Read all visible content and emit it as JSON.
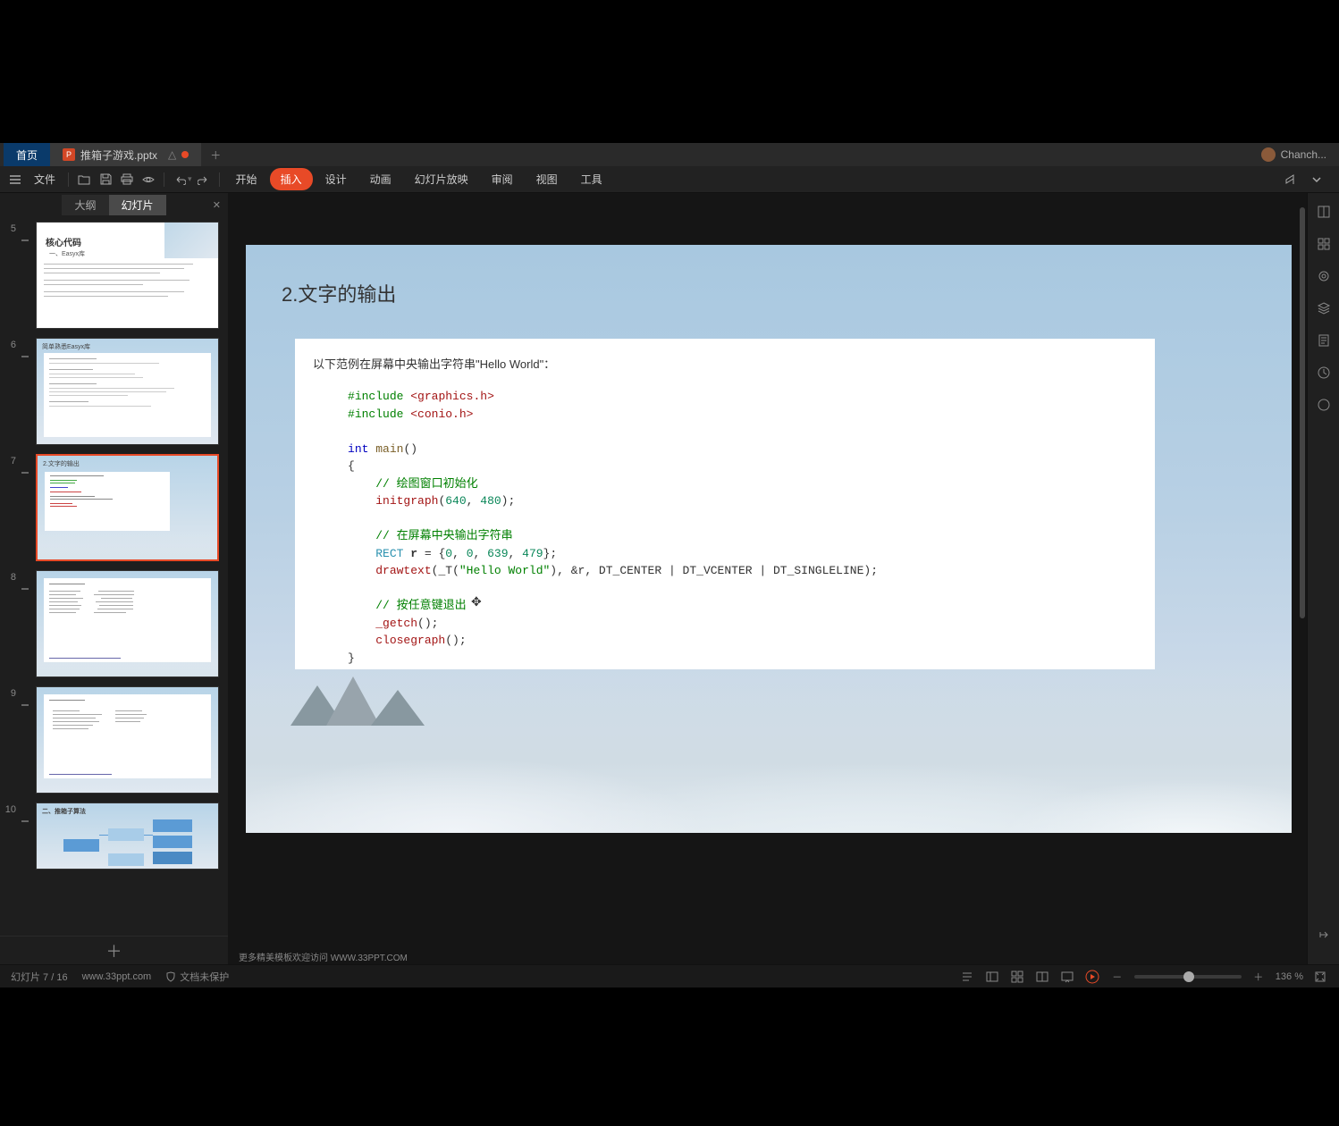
{
  "tabs": {
    "home": "首页",
    "file_name": "推箱子游戏.pptx",
    "user": "Chanch..."
  },
  "menu": {
    "file": "文件",
    "items": [
      "开始",
      "插入",
      "设计",
      "动画",
      "幻灯片放映",
      "审阅",
      "视图",
      "工具"
    ],
    "active_index": 1
  },
  "thumb_panel": {
    "tab_outline": "大纲",
    "tab_slides": "幻灯片",
    "slides": [
      {
        "num": 5,
        "title": "核心代码",
        "sub": "一、Easyx库"
      },
      {
        "num": 6,
        "title": "简单熟悉Easyx库"
      },
      {
        "num": 7,
        "title": "2.文字的输出",
        "selected": true
      },
      {
        "num": 8,
        "title": ""
      },
      {
        "num": 9,
        "title": ""
      },
      {
        "num": 10,
        "title": "二、推箱子算法"
      }
    ]
  },
  "slide": {
    "title": "2.文字的输出",
    "desc": "以下范例在屏幕中央输出字符串\"Hello World\"：",
    "code": {
      "inc1_kw": "#include",
      "inc1_h": "<graphics.h>",
      "inc2_kw": "#include",
      "inc2_h": "<conio.h>",
      "int": "int",
      "main": "main",
      "cmt1": "// 绘图窗口初始化",
      "initgraph": "initgraph",
      "n640": "640",
      "n480": "480",
      "cmt2": "// 在屏幕中央输出字符串",
      "rect_t": "RECT",
      "rect_v": "r",
      "n0a": "0",
      "n0b": "0",
      "n639": "639",
      "n479": "479",
      "drawtext": "drawtext",
      "t_macro": "_T",
      "hello": "\"Hello World\"",
      "amp_r": "&r",
      "dtc": "DT_CENTER",
      "dtv": "DT_VCENTER",
      "dts": "DT_SINGLELINE",
      "cmt3": "// 按任意键退出",
      "getch": "_getch",
      "closegraph": "closegraph"
    }
  },
  "footer_link": "更多精美模板欢迎访问 WWW.33PPT.COM",
  "status": {
    "slide_count": "幻灯片 7 / 16",
    "website": "www.33ppt.com",
    "protection": "文档未保护",
    "zoom": "136 %"
  }
}
